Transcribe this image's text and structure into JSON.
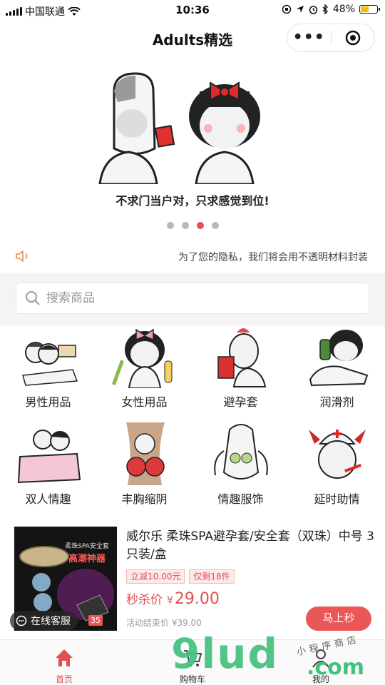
{
  "status_bar": {
    "carrier": "中国联通",
    "time": "10:36",
    "battery": "48%",
    "battery_level": 0.48
  },
  "nav": {
    "title": "Adults精选",
    "more_label": "•••"
  },
  "banner": {
    "caption": "不求门当户对，只求感觉到位!",
    "dots": [
      false,
      false,
      true,
      false
    ]
  },
  "notice": {
    "text": "为了您的隐私，我们将会用不透明材料封装"
  },
  "search": {
    "placeholder": "搜索商品"
  },
  "categories": [
    {
      "label": "男性用品"
    },
    {
      "label": "女性用品"
    },
    {
      "label": "避孕套"
    },
    {
      "label": "润滑剂"
    },
    {
      "label": "双人情趣"
    },
    {
      "label": "丰胸缩阴"
    },
    {
      "label": "情趣服饰"
    },
    {
      "label": "延时助情"
    }
  ],
  "product": {
    "title": "威尔乐 柔珠SPA避孕套/安全套（双珠）中号 3只装/盒",
    "image_brand": "柔珠SPA安全套",
    "image_slogan": "高潮神器",
    "tag_discount": "立减10.00元",
    "tag_stock": "仅剩18件",
    "price_label": "秒杀价",
    "currency": "¥",
    "price": "29.00",
    "end_price_label": "活动结束价 ¥39.00",
    "buy_label": "马上秒",
    "countdown": "35"
  },
  "customer_service": {
    "label": "在线客服"
  },
  "tabbar": [
    {
      "label": "首页",
      "active": true
    },
    {
      "label": "购物车",
      "active": false
    },
    {
      "label": "我的",
      "active": false
    }
  ],
  "watermark": {
    "main": "9lud",
    "suffix": ".com",
    "small": "小程序商店"
  },
  "colors": {
    "accent": "#e05050",
    "button": "#e95757",
    "watermark": "#43c17e"
  }
}
